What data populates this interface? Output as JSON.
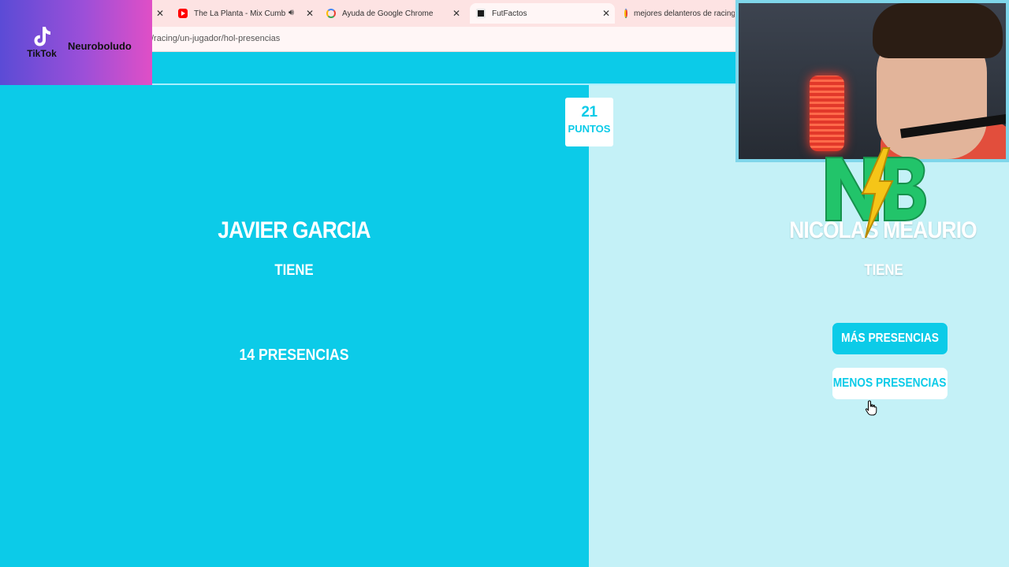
{
  "browser": {
    "tabs": [
      {
        "title": "",
        "favicon": "none"
      },
      {
        "title": "The La Planta - Mix Cumbia",
        "favicon": "youtube-icon",
        "audio": true
      },
      {
        "title": "Ayuda de Google Chrome",
        "favicon": "google-icon"
      },
      {
        "title": "FutFactos",
        "favicon": "futfactos-icon",
        "active": true
      },
      {
        "title": "mejores delanteros de racing",
        "favicon": "google-icon"
      }
    ],
    "url": "/racing/un-jugador/hol-presencias"
  },
  "game": {
    "score_value": "21",
    "score_label": "PUNTOS",
    "left_player": {
      "name": "JAVIER GARCIA",
      "verb": "TIENE",
      "stat": "14 PRESENCIAS"
    },
    "right_player": {
      "name": "NICOLAS MEAURIO",
      "verb": "TIENE"
    },
    "buttons": {
      "higher": "MÁS PRESENCIAS",
      "lower": "MENOS PRESENCIAS"
    }
  },
  "overlay": {
    "platform": "TikTok",
    "username": "Neuroboludo",
    "logo_letters": "NB"
  },
  "colors": {
    "primary": "#0ccbe8",
    "right_bg": "#c4f1f7",
    "tab_bar": "#fde3e3",
    "tiktok_gradient_start": "#5b4bd6",
    "tiktok_gradient_end": "#e04fc6",
    "nb_green": "#22c46a",
    "nb_bolt": "#f5c518"
  }
}
